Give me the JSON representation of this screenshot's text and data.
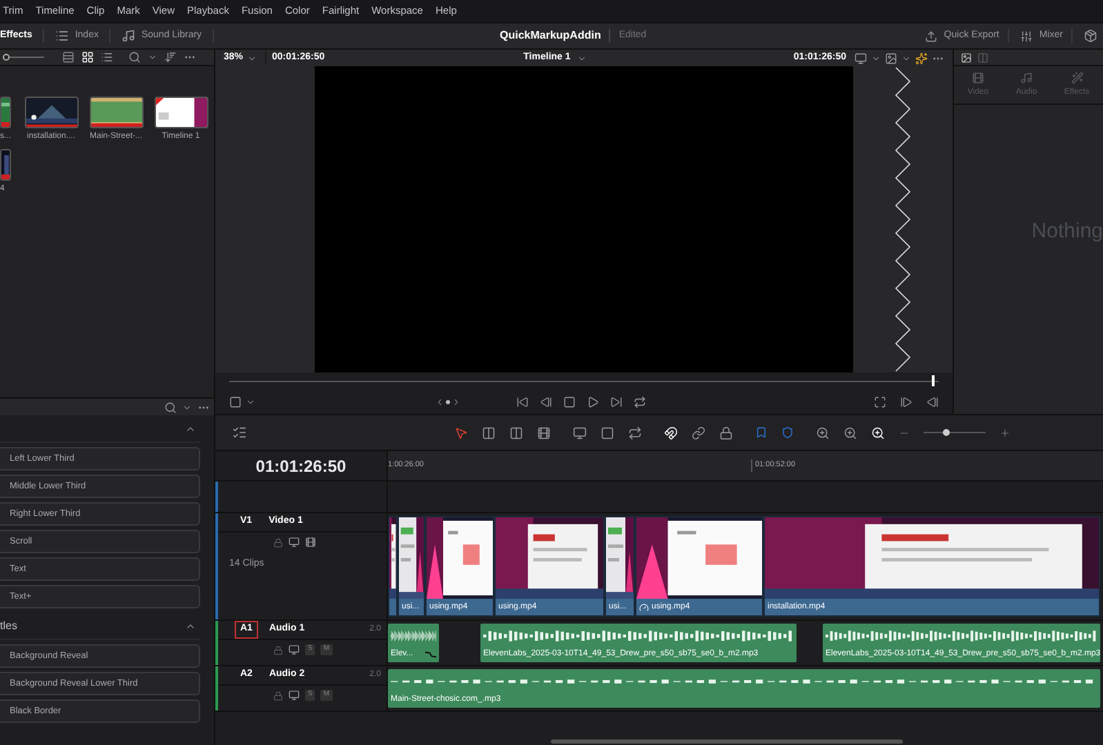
{
  "menu": [
    "Trim",
    "Timeline",
    "Clip",
    "Mark",
    "View",
    "Playback",
    "Fusion",
    "Color",
    "Fairlight",
    "Workspace",
    "Help"
  ],
  "toolbar": {
    "pages": [
      {
        "label": "Effects",
        "selected": true
      },
      {
        "label": "Index",
        "selected": false
      },
      {
        "label": "Sound Library",
        "selected": false
      }
    ],
    "project_title": "QuickMarkupAddin",
    "project_status": "Edited",
    "actions": [
      "Quick Export",
      "Mixer"
    ]
  },
  "media_pool": {
    "thumbnail_size": {
      "level": 0
    },
    "rows": [
      [
        {
          "name": "s..."
        },
        {
          "name": "installation...."
        },
        {
          "name": "Main-Street-..."
        },
        {
          "name": "Timeline 1"
        }
      ],
      [
        {
          "name": "4"
        }
      ]
    ]
  },
  "viewer": {
    "zoom": "38%",
    "source_timecode": "00:01:26:50",
    "timeline": "Timeline 1",
    "timecode": "01:01:26:50",
    "scrubber": {
      "level": 0.99
    }
  },
  "inspector": {
    "tabs": [
      {
        "label": "Video",
        "disabled": true
      },
      {
        "label": "Audio",
        "disabled": true
      },
      {
        "label": "Effects",
        "disabled": true
      }
    ],
    "message": "Nothing"
  },
  "effects": {
    "groups": [
      {
        "expanded": true,
        "items": [
          "Left Lower Third",
          "Middle Lower Third",
          "Right Lower Third",
          "Scroll",
          "Text",
          "Text+"
        ]
      },
      {
        "title": "tles",
        "expanded": true,
        "items": [
          "Background Reveal",
          "Background Reveal Lower Third",
          "Black Border"
        ]
      }
    ]
  },
  "timeline": {
    "timecode": "01:01:26:50",
    "ruler": [
      "1:00:26:00",
      "01:00:52:00"
    ],
    "zoom": {
      "level": 0.3
    },
    "tracks": [
      {
        "kind": "video",
        "id_label": "V1",
        "name": "Video 1",
        "info": "14 Clips",
        "clips": [
          {
            "retimed": false
          },
          {
            "label": "usi...",
            "retimed": false
          },
          {
            "label": "using.mp4",
            "retimed": false
          },
          {
            "label": "using.mp4",
            "retimed": false
          },
          {
            "label": "usi...",
            "retimed": false
          },
          {
            "label": "using.mp4",
            "retimed": true
          },
          {
            "label": "installation.mp4",
            "retimed": false
          }
        ]
      },
      {
        "kind": "audio",
        "id_label": "A1",
        "name": "Audio 1",
        "channels": "2.0",
        "patched": true,
        "buttons": [
          "S",
          "M"
        ],
        "clips": [
          {
            "label": "Elev...",
            "fade": true
          },
          {
            "label": "ElevenLabs_2025-03-10T14_49_53_Drew_pre_s50_sb75_se0_b_m2.mp3",
            "fade": false
          },
          {
            "label": "ElevenLabs_2025-03-10T14_49_53_Drew_pre_s50_sb75_se0_b_m2.mp3",
            "fade": false
          }
        ]
      },
      {
        "kind": "audio",
        "id_label": "A2",
        "name": "Audio 2",
        "channels": "2.0",
        "patched": false,
        "buttons": [
          "S",
          "M"
        ],
        "clips": [
          {
            "label": "Main-Street-chosic.com_.mp3",
            "fade": false
          }
        ]
      }
    ]
  }
}
